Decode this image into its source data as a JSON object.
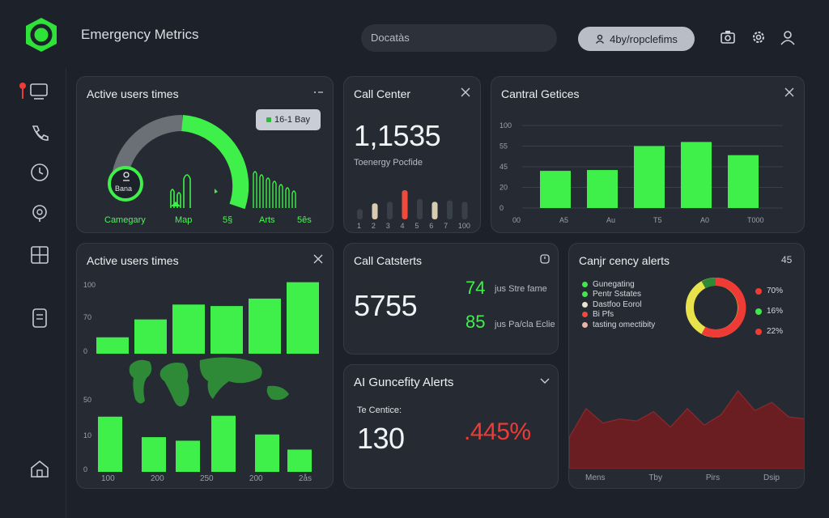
{
  "header": {
    "title": "Emergency Metrics",
    "search_value": "Docatàs",
    "user_label": "4by/ropclefims"
  },
  "cards": {
    "active_users_gauge": {
      "title": "Active users times",
      "tooltip": "16-1 Bay",
      "ring_label": "Bana",
      "labels": [
        "Camegary",
        "Map",
        "5§",
        "Arts",
        "5ês"
      ]
    },
    "call_center": {
      "title": "Call Center",
      "value": "1,1535",
      "sublabel": "Toenergy Pocfide",
      "x_ticks": [
        "1",
        "2",
        "3",
        "4",
        "5",
        "6",
        "7",
        "100"
      ]
    },
    "central_services": {
      "title": "Cantral Getices",
      "y_ticks": [
        "100",
        "55",
        "45",
        "20",
        "0"
      ],
      "x_ticks": [
        "00",
        "A5",
        "Au",
        "T5",
        "A0",
        "T000",
        "A0"
      ]
    },
    "active_users_map": {
      "title": "Active users times",
      "top_y_ticks": [
        "100",
        "70",
        "0"
      ],
      "bottom_y_ticks": [
        "50",
        "10",
        "0"
      ],
      "x_ticks": [
        "100",
        "200",
        "250",
        "200",
        "2ås"
      ]
    },
    "call_catsterts": {
      "title": "Call Catsterts",
      "value": "5755",
      "stat1_value": "74",
      "stat1_label": "jus Stre fame",
      "stat2_value": "85",
      "stat2_label": "jus Pa/cla Eclie"
    },
    "ai_alerts": {
      "title": "AI Guncefity Alerts",
      "sublabel": "Te Centice:",
      "value": "130",
      "percent": ".445%"
    },
    "capacity_alerts": {
      "title": "Canjr cency alerts",
      "corner": "45",
      "legend": [
        "Gunegating",
        "Pentr Sstates",
        "Dastfoo Eorol",
        "Bi Pfs",
        "tasting omectibity"
      ],
      "legend_colors": [
        "#41e84a",
        "#41e84a",
        "#e9e3d0",
        "#ef4a3b",
        "#e8b5a5"
      ],
      "stats": [
        "70%",
        "16%",
        "22%"
      ],
      "stat_colors": [
        "#ef3b36",
        "#41e84a",
        "#ef3b36"
      ],
      "x_ticks": [
        "Mens",
        "Tby",
        "Pirs",
        "Dsip"
      ]
    }
  },
  "chart_data": [
    {
      "type": "bar",
      "title": "Cantral Getices",
      "categories": [
        "A5",
        "Au",
        "T5",
        "A0",
        "T000"
      ],
      "values": [
        45,
        46,
        75,
        80,
        64
      ],
      "ylim": [
        0,
        100
      ],
      "color": "#3ff04a"
    },
    {
      "type": "bar",
      "title": "Active users times",
      "values": [
        22,
        46,
        66,
        64,
        74,
        96
      ],
      "ylim": [
        0,
        100
      ],
      "color": "#3ff04a"
    },
    {
      "type": "bar",
      "values": [
        62,
        39,
        35,
        63,
        42,
        25
      ],
      "ylim": [
        0,
        100
      ],
      "color": "#3ff04a"
    },
    {
      "type": "bar",
      "title": "Call Center",
      "categories": [
        "1",
        "2",
        "3",
        "4",
        "5",
        "6",
        "7",
        "100"
      ],
      "values": [
        14,
        22,
        24,
        40,
        28,
        24,
        26,
        24
      ],
      "colors": [
        "#39404a",
        "#d8ccb0",
        "#39404a",
        "#ef4a3b",
        "#39404a",
        "#d8ccb0",
        "#39404a",
        "#39404a"
      ]
    },
    {
      "type": "area",
      "title": "Canjr cency alerts",
      "values": [
        30,
        58,
        44,
        48,
        46,
        55,
        40,
        58,
        42,
        52,
        75,
        56,
        64,
        50,
        48
      ],
      "ylim": [
        0,
        100
      ],
      "color": "#6b1e22"
    }
  ]
}
